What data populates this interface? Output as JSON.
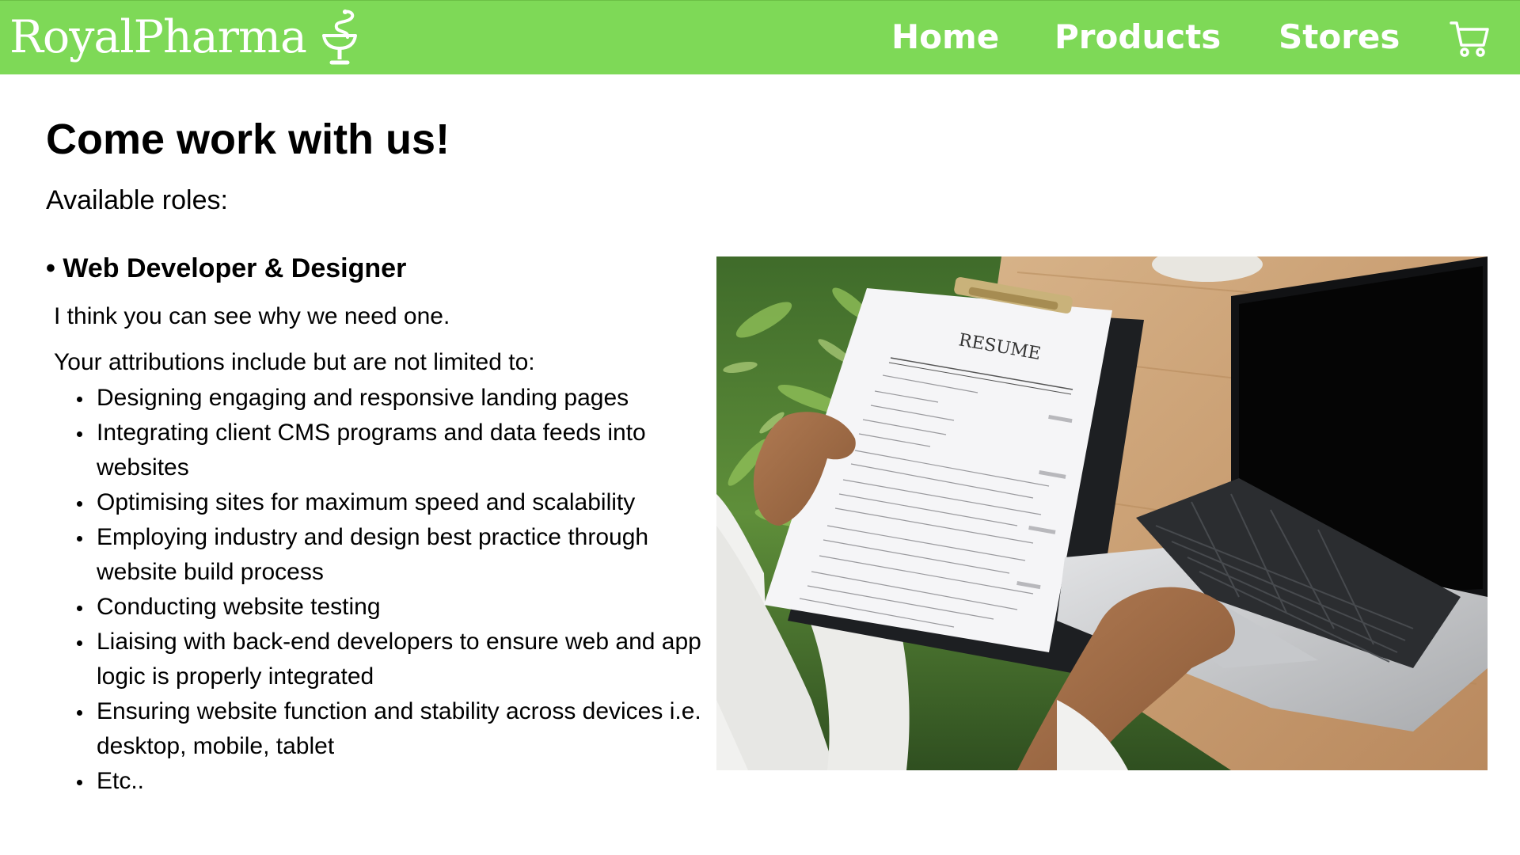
{
  "header": {
    "logo_text": "RoyalPharma",
    "logo_icon": "bowl-of-hygieia-icon",
    "nav": [
      {
        "label": "Home"
      },
      {
        "label": "Products"
      },
      {
        "label": "Stores"
      }
    ],
    "cart_icon": "shopping-cart-icon",
    "colors": {
      "background": "#7ed957",
      "text": "#ffffff"
    }
  },
  "main": {
    "title": "Come work with us!",
    "roles_label": "Available roles:",
    "role": {
      "title": "• Web Developer & Designer",
      "intro": "I think you can see why we need one.",
      "attributions_label": "Your attributions include but are not limited to:",
      "attributions": [
        "Designing engaging and responsive landing pages",
        "Integrating client CMS programs and data feeds into websites",
        "Optimising sites for maximum speed and scalability",
        "Employing industry and design best practice through website build process",
        "Conducting website testing",
        "Liaising with back-end developers to ensure web and app logic is properly integrated",
        "Ensuring website function and stability across devices i.e. desktop, mobile, tablet",
        "Etc.."
      ]
    },
    "photo": {
      "resume_heading": "RESUME"
    }
  }
}
